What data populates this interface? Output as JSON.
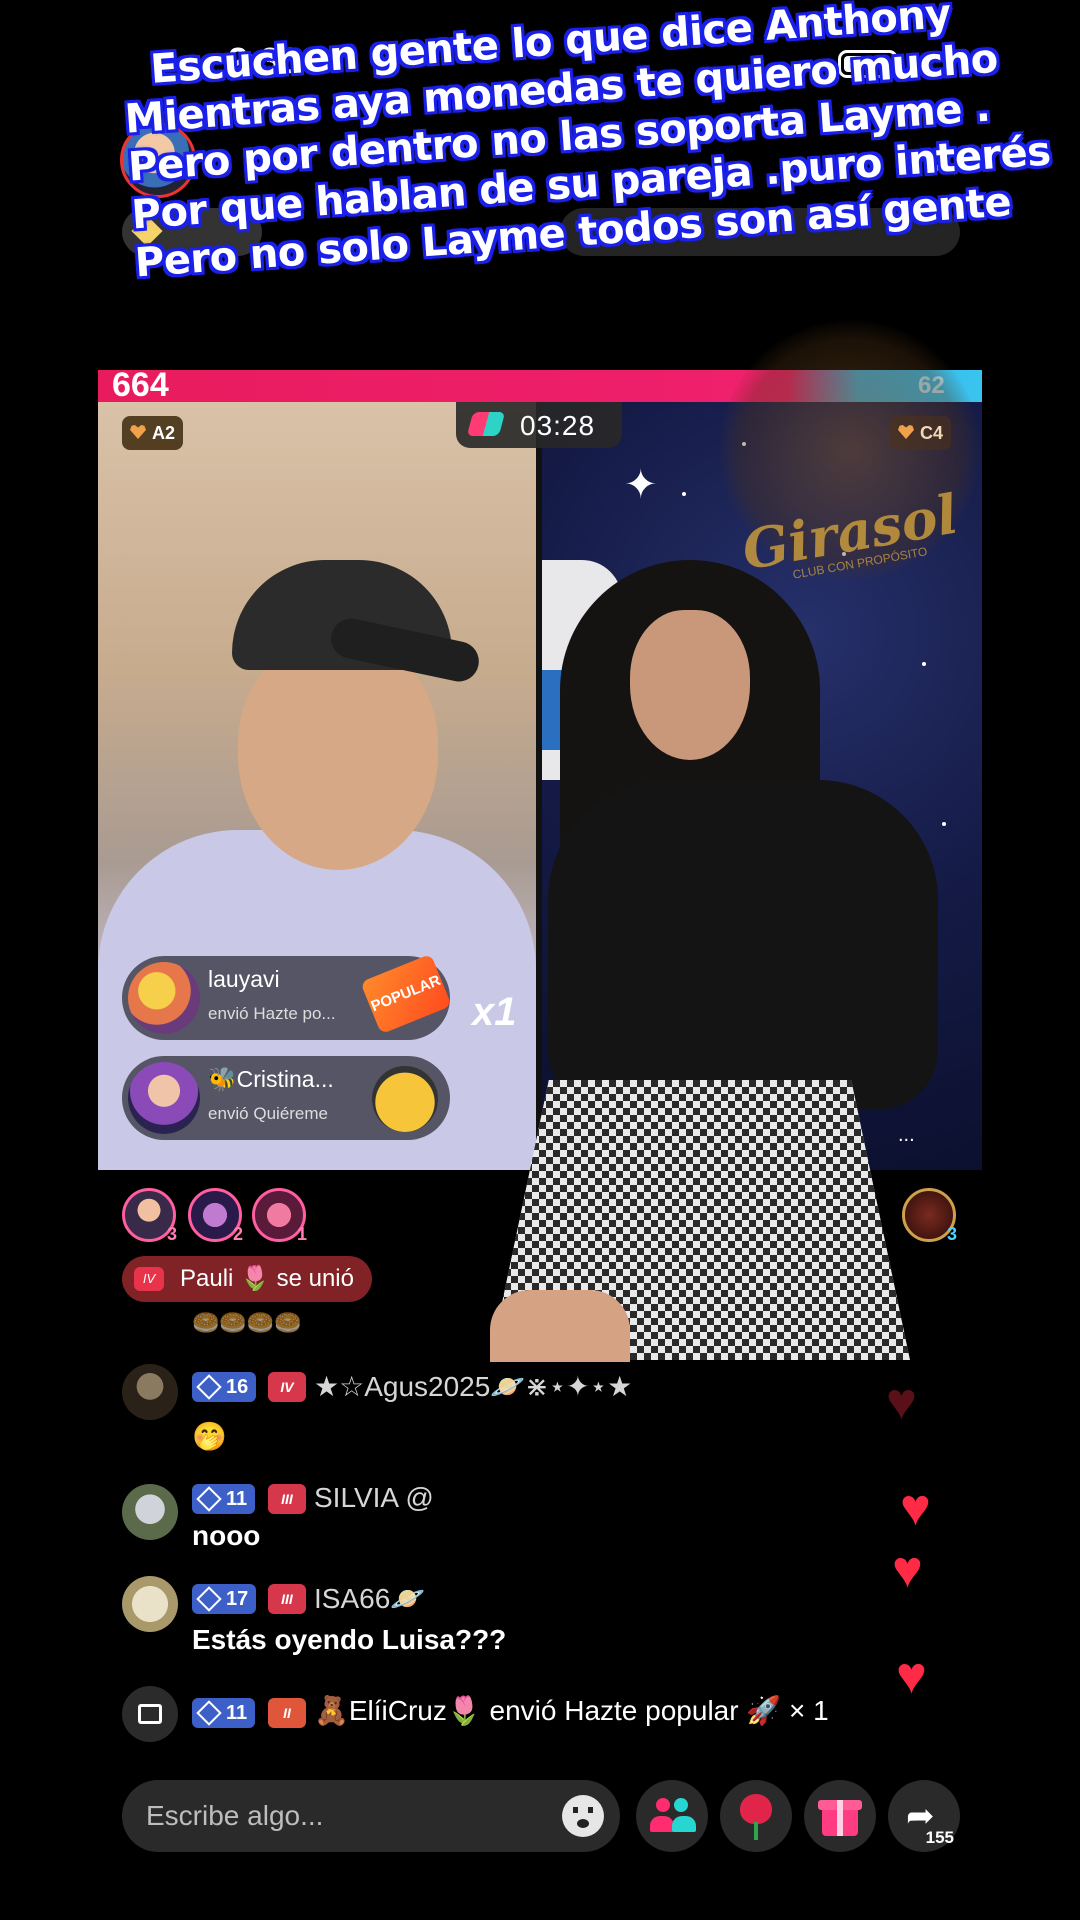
{
  "status_bar": {
    "time": "2:36"
  },
  "caption": {
    "lines": [
      "Escuchen gente  lo que dice Anthony",
      "Mientras aya monedas te quiero mucho",
      "Pero por dentro no las soporta Layme .",
      "Por que hablan de su pareja .puro interés",
      "Pero no solo Layme todos son así gente"
    ]
  },
  "battle": {
    "left_score": "664",
    "right_score": "62",
    "timer": "03:28",
    "left_badge": "A2",
    "right_badge": "C4",
    "right_brand": "Girasol",
    "right_brand_sub": "CLUB CON PROPÓSITO",
    "multiplier": "x1",
    "popular_sticker": "POPULAR",
    "more_indicator": "..."
  },
  "gift_toasts": [
    {
      "name": "lauyavi",
      "action": "envió Hazte po..."
    },
    {
      "name": "🐝Cristina...",
      "action": "envió Quiéreme"
    }
  ],
  "top_gifters": [
    {
      "rank": "3"
    },
    {
      "rank": "2"
    },
    {
      "rank": "1"
    }
  ],
  "opponent_gifter": {
    "rank": "3"
  },
  "joined": {
    "level": "IV",
    "text": "Pauli 🌷 se unió"
  },
  "partial_row": "🥯🥯🥯🥯",
  "chat": [
    {
      "level": "16",
      "fan": "IV",
      "name": "★☆Agus2025🪐⋇⋆✦⋆★",
      "message": "🤭"
    },
    {
      "level": "11",
      "fan": "III",
      "name": "SILVIA @",
      "message": "nooo"
    },
    {
      "level": "17",
      "fan": "III",
      "name": "ISA66🪐",
      "message": "Estás oyendo Luisa???"
    }
  ],
  "gift_line": {
    "level": "11",
    "fan": "II",
    "text": "🧸ElíiCruz🌷 envió Hazte popular 🚀 × 1"
  },
  "bottom_bar": {
    "placeholder": "Escribe algo...",
    "share_count": "155"
  },
  "colors": {
    "score_left": "#f0206d",
    "score_right": "#39c4ef",
    "level_badge": "#3c5fc8",
    "fan_badge": "#d7374a",
    "caption_stroke": "#1a20e8"
  }
}
